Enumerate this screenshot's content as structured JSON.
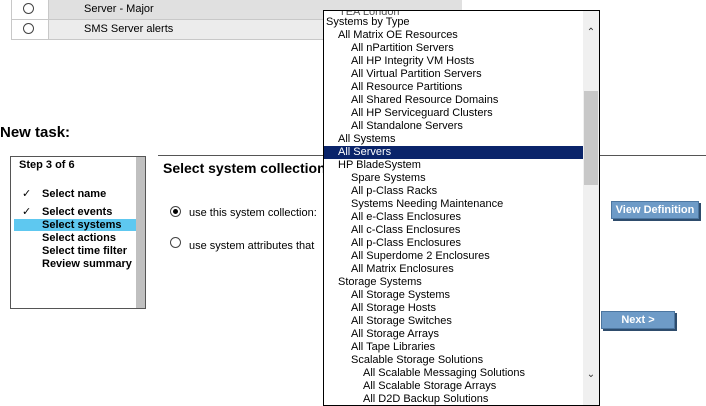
{
  "top_table": {
    "rows": [
      {
        "label": "Server - Major"
      },
      {
        "label": "SMS Server alerts"
      }
    ]
  },
  "dropdown_behind_text": "TEA London",
  "new_task_heading": "New task:",
  "step_panel": {
    "title": "Step  3  of 6",
    "steps": [
      {
        "label": "Select name",
        "checked": true
      },
      {
        "label": "Select events",
        "checked": true
      },
      {
        "label": "Select systems",
        "active": true
      },
      {
        "label": "Select actions"
      },
      {
        "label": "Select time filter"
      },
      {
        "label": "Review summary"
      }
    ]
  },
  "section_title": "Select system collection",
  "options": {
    "use_collection": "use this system collection:",
    "use_attributes": "use system attributes that"
  },
  "buttons": {
    "view_definition": "View Definition",
    "next": "Next >"
  },
  "dropdown": {
    "items": [
      {
        "label": "Systems by Type",
        "level": 0
      },
      {
        "label": "All Matrix OE Resources",
        "level": 1
      },
      {
        "label": "All nPartition Servers",
        "level": 2
      },
      {
        "label": "All HP Integrity VM Hosts",
        "level": 2
      },
      {
        "label": "All Virtual Partition Servers",
        "level": 2
      },
      {
        "label": "All Resource Partitions",
        "level": 2
      },
      {
        "label": "All Shared Resource Domains",
        "level": 2
      },
      {
        "label": "All HP Serviceguard Clusters",
        "level": 2
      },
      {
        "label": "All Standalone Servers",
        "level": 2
      },
      {
        "label": "All Systems",
        "level": 1
      },
      {
        "label": "All Servers",
        "level": 1,
        "selected": true
      },
      {
        "label": "HP BladeSystem",
        "level": 1
      },
      {
        "label": "Spare Systems",
        "level": 2
      },
      {
        "label": "All p-Class Racks",
        "level": 2
      },
      {
        "label": "Systems Needing Maintenance",
        "level": 2
      },
      {
        "label": "All e-Class Enclosures",
        "level": 2
      },
      {
        "label": "All c-Class Enclosures",
        "level": 2
      },
      {
        "label": "All p-Class Enclosures",
        "level": 2
      },
      {
        "label": "All Superdome 2 Enclosures",
        "level": 2
      },
      {
        "label": "All Matrix Enclosures",
        "level": 2
      },
      {
        "label": "Storage Systems",
        "level": 1
      },
      {
        "label": "All Storage Systems",
        "level": 2
      },
      {
        "label": "All Storage Hosts",
        "level": 2
      },
      {
        "label": "All Storage Switches",
        "level": 2
      },
      {
        "label": "All Storage Arrays",
        "level": 2
      },
      {
        "label": "All Tape Libraries",
        "level": 2
      },
      {
        "label": "Scalable Storage Solutions",
        "level": 2
      },
      {
        "label": "All Scalable Messaging Solutions",
        "level": 3
      },
      {
        "label": "All Scalable Storage Arrays",
        "level": 3
      },
      {
        "label": "All D2D Backup Solutions",
        "level": 3
      }
    ]
  }
}
